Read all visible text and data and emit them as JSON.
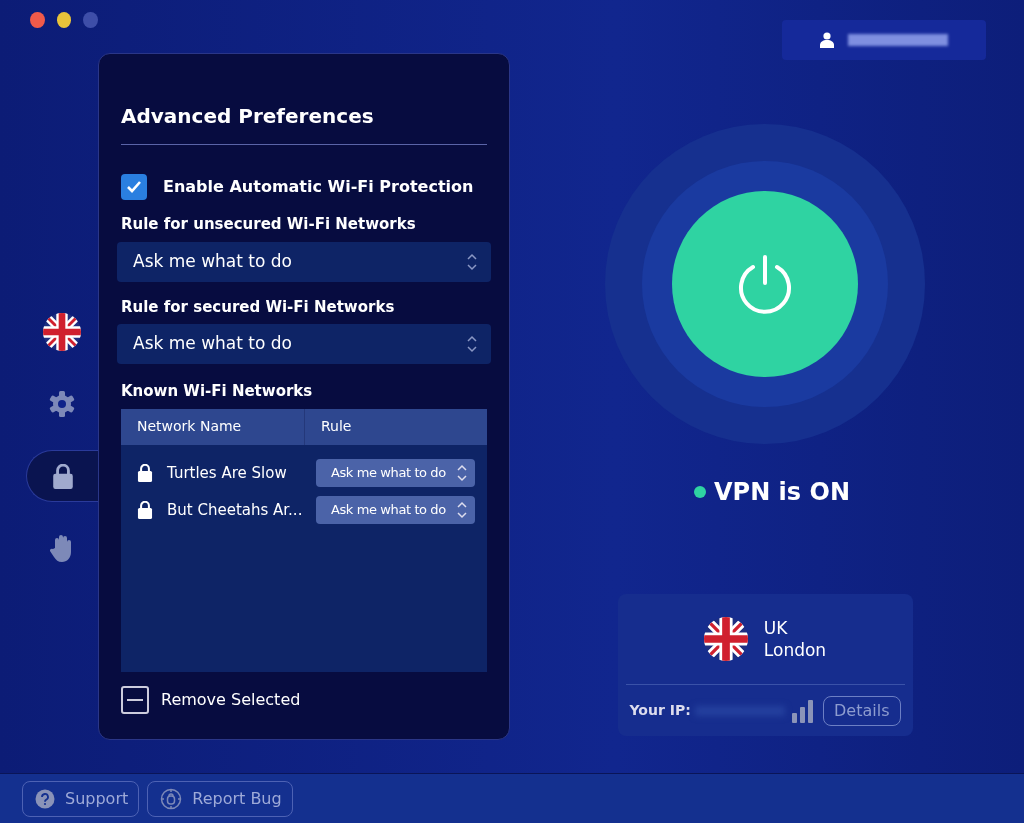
{
  "sidebar": {
    "items": [
      {
        "kind": "flag",
        "selected": false
      },
      {
        "kind": "gear",
        "selected": false
      },
      {
        "kind": "lock",
        "selected": true
      },
      {
        "kind": "hand",
        "selected": false
      }
    ]
  },
  "preferences": {
    "title": "Advanced Preferences",
    "auto_protection": {
      "label": "Enable Automatic Wi-Fi Protection",
      "checked": true
    },
    "rules": [
      {
        "label": "Rule for unsecured Wi-Fi Networks",
        "value": "Ask me what to do"
      },
      {
        "label": "Rule for secured Wi-Fi Networks",
        "value": "Ask me what to do"
      }
    ],
    "known_networks": {
      "label": "Known Wi-Fi Networks",
      "columns": [
        "Network Name",
        "Rule"
      ],
      "rows": [
        {
          "name": "Turtles Are Slow",
          "rule": "Ask me what to do"
        },
        {
          "name": "But Cheetahs Ar...",
          "rule": "Ask me what to do"
        }
      ]
    },
    "remove_button": "Remove Selected"
  },
  "vpn": {
    "on": true,
    "status": "VPN is ON"
  },
  "location": {
    "country": "UK",
    "city": "London",
    "ip_label": "Your IP:",
    "details_button": "Details"
  },
  "footer": {
    "buttons": [
      {
        "kind": "support",
        "label": "Support"
      },
      {
        "kind": "bug",
        "label": "Report Bug"
      }
    ]
  }
}
